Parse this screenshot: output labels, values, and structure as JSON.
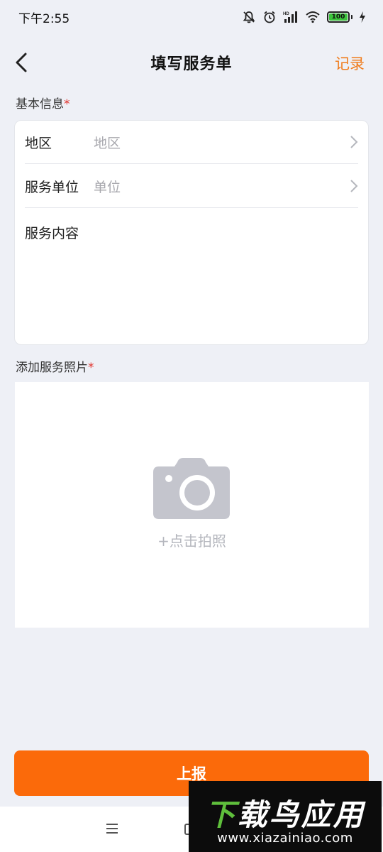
{
  "status_bar": {
    "time": "下午2:55",
    "battery_level": "100",
    "icons": [
      "mute-icon",
      "alarm-icon",
      "hd-signal-icon",
      "wifi-icon",
      "battery-icon",
      "charging-icon"
    ]
  },
  "nav": {
    "title": "填写服务单",
    "back_icon": "chevron-left-icon",
    "record_label": "记录"
  },
  "basic_info": {
    "label": "基本信息",
    "required_mark": "*",
    "region": {
      "label": "地区",
      "placeholder": "地区"
    },
    "unit": {
      "label": "服务单位",
      "placeholder": "单位"
    },
    "content": {
      "label": "服务内容",
      "value": ""
    }
  },
  "photos": {
    "label": "添加服务照片",
    "required_mark": "*",
    "caption": "+点击拍照",
    "icon": "camera-icon"
  },
  "submit": {
    "label": "上报"
  },
  "watermark": {
    "brand_first": "下",
    "brand_rest": "载鸟应用",
    "url": "www.xiazainiao.com"
  },
  "colors": {
    "accent": "#f07c1c",
    "button": "#fb6a0a",
    "required": "#e0302a",
    "background": "#eef0f6"
  }
}
